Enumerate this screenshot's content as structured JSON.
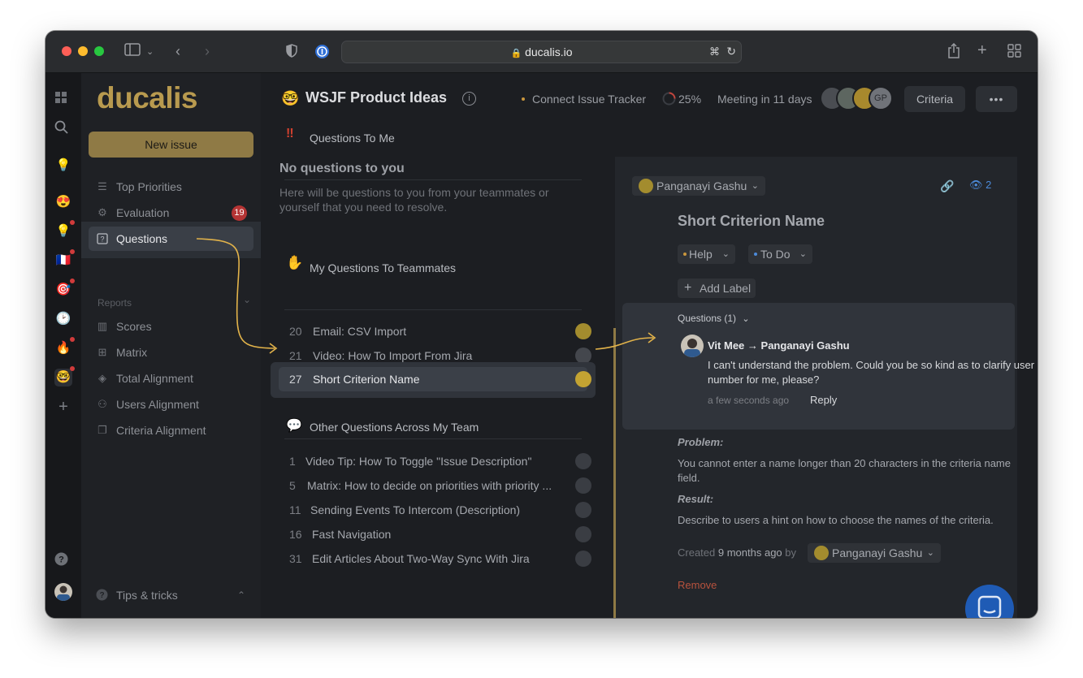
{
  "browser": {
    "url": "ducalis.io"
  },
  "sidebar": {
    "logo": "ducalis",
    "new_issue": "New issue",
    "items": [
      {
        "label": "Top Priorities"
      },
      {
        "label": "Evaluation",
        "badge": "19"
      },
      {
        "label": "Questions"
      }
    ],
    "reports_label": "Reports",
    "reports": [
      {
        "label": "Scores"
      },
      {
        "label": "Matrix"
      },
      {
        "label": "Total Alignment"
      },
      {
        "label": "Users Alignment"
      },
      {
        "label": "Criteria Alignment"
      }
    ],
    "tips": "Tips & tricks"
  },
  "header": {
    "title": "WSJF Product Ideas",
    "connect": "Connect Issue Tracker",
    "progress": "25%",
    "meeting": "Meeting in 11 days",
    "avatar_initials": "GP",
    "criteria_button": "Criteria",
    "more_button": "•••"
  },
  "questions_to_me": {
    "title": "Questions To Me",
    "empty_title": "No questions to you",
    "empty_text": "Here will be questions to you from your teammates or yourself that you need to resolve."
  },
  "my_questions": {
    "title": "My Questions To Teammates",
    "rows": [
      {
        "num": "20",
        "text": "Email: CSV Import"
      },
      {
        "num": "21",
        "text": "Video: How To Import From Jira"
      },
      {
        "num": "27",
        "text": "Short Criterion Name"
      }
    ]
  },
  "other_questions": {
    "title": "Other Questions Across My Team",
    "rows": [
      {
        "num": "1",
        "text": "Video Tip: How To Toggle \"Issue Description\""
      },
      {
        "num": "5",
        "text": "Matrix: How to decide on priorities with priority ..."
      },
      {
        "num": "11",
        "text": "Sending Events To Intercom (Description)"
      },
      {
        "num": "16",
        "text": "Fast Navigation"
      },
      {
        "num": "31",
        "text": "Edit Articles About Two-Way Sync With Jira"
      }
    ]
  },
  "detail": {
    "assignee": "Panganayi Gashu",
    "watchers": "2",
    "title": "Short Criterion Name",
    "type_chip": "Help",
    "status_chip": "To Do",
    "add_label": "Add Label",
    "questions_header": "Questions (1)",
    "question": {
      "from": "Vit Mee",
      "arrow": "→",
      "to": "Panganayi Gashu",
      "text": "I can't understand the problem. Could you be so kind as to clarify user number for me, please?",
      "time": "a few seconds ago",
      "reply": "Reply"
    },
    "problem_label": "Problem:",
    "problem_text": "You cannot enter a name longer than 20 characters in the criteria name field.",
    "result_label": "Result:",
    "result_text": "Describe to users a hint on how to choose the names of the criteria.",
    "created_prefix": "Created",
    "created_time": "9 months ago",
    "created_by": "by",
    "creator": "Panganayi Gashu",
    "remove": "Remove"
  },
  "colors": {
    "accent": "#b89a4f",
    "active_row": "#3a3f47",
    "annotation": "#e2b34a",
    "badge": "#b53434",
    "link_blue": "#4c8ad9"
  }
}
